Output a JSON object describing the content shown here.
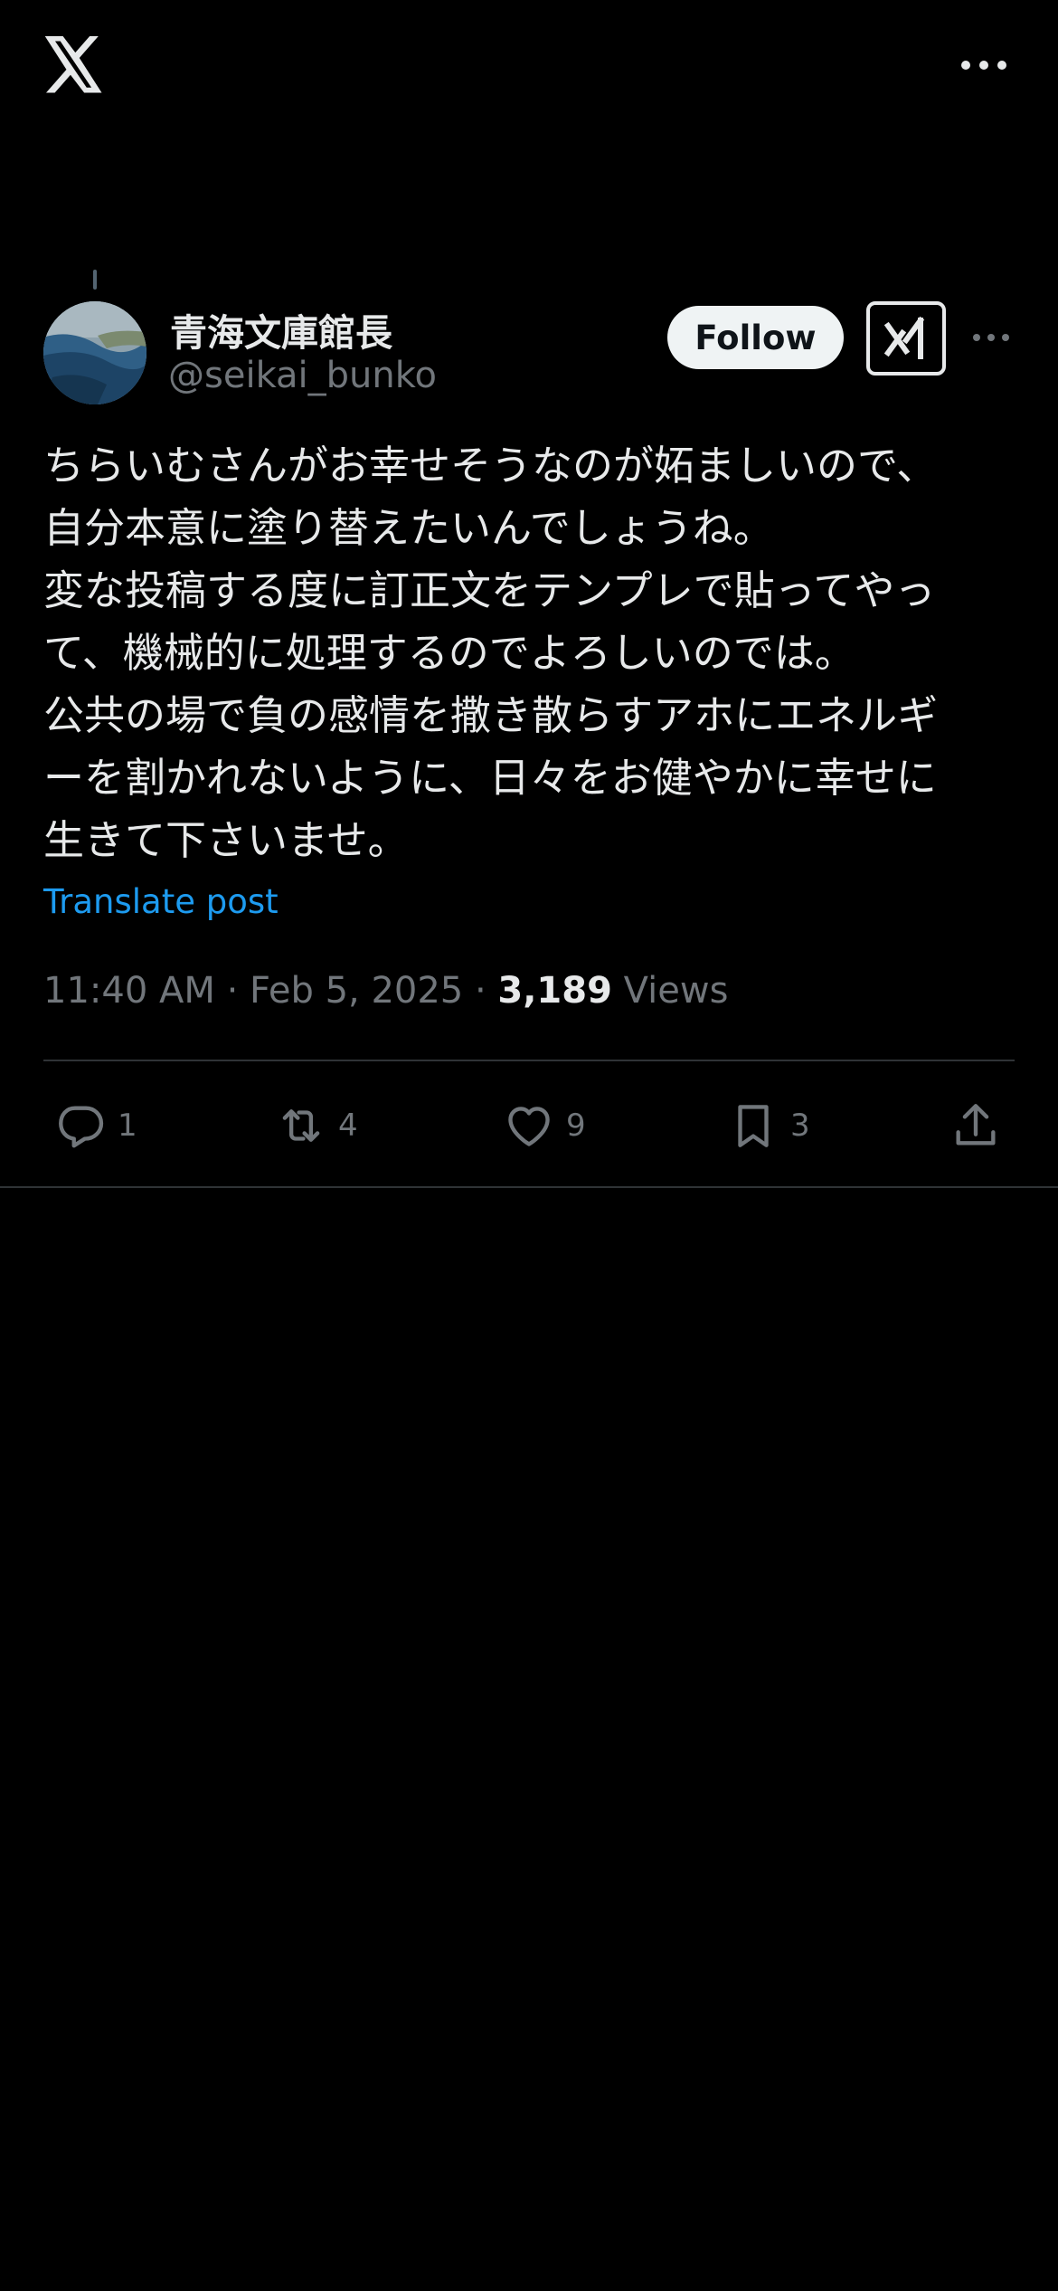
{
  "app": {
    "logo_icon": "x-logo-icon",
    "more_icon": "more-horizontal-icon"
  },
  "author": {
    "display_name": "青海文庫館長",
    "handle": "@seikai_bunko",
    "avatar_icon": "avatar-icon",
    "follow_label": "Follow",
    "grok_icon": "grok-icon",
    "more_icon": "more-horizontal-icon"
  },
  "post": {
    "text": "ちらいむさんがお幸せそうなのが妬ましいので、\n自分本意に塗り替えたいんでしょうね。\n変な投稿する度に訂正文をテンプレで貼ってやっ\nて、機械的に処理するのでよろしいのでは。\n公共の場で負の感情を撒き散らすアホにエネルギ\nーを割かれないように、日々をお健やかに幸せに\n生きて下さいませ。",
    "translate_label": "Translate post",
    "time": "11:40 AM",
    "separator": "·",
    "date": "Feb 5, 2025",
    "views_count": "3,189",
    "views_label": "Views"
  },
  "actions": {
    "replies": "1",
    "reposts": "4",
    "likes": "9",
    "bookmarks": "3"
  },
  "colors": {
    "background": "#000000",
    "text_primary": "#e7e9ea",
    "text_secondary": "#71767b",
    "link": "#1d9bf0",
    "divider": "#2f3336"
  }
}
